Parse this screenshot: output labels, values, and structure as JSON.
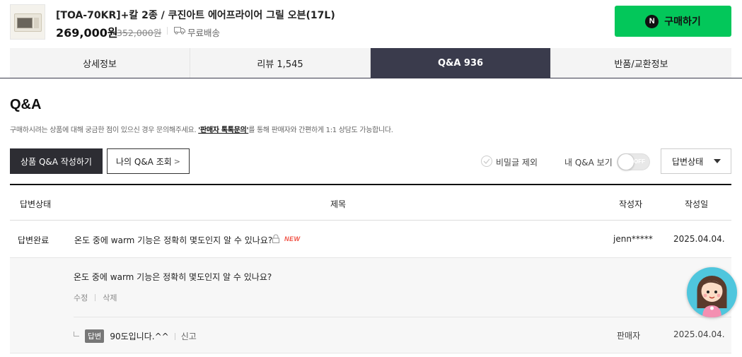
{
  "product": {
    "title": "[TOA-70KR]+칼 2종 / 쿠진아트 에어프라이어 그릴 오븐(17L)",
    "price": "269,000원",
    "original_price": "352,000원",
    "shipping": "무료배송",
    "buy_label": "구매하기",
    "naver_badge": "N",
    "buy_color": "#03c75a"
  },
  "tabs": [
    {
      "label": "상세정보",
      "active": false
    },
    {
      "label": "리뷰 1,545",
      "active": false
    },
    {
      "label": "Q&A 936",
      "active": true
    },
    {
      "label": "반품/교환정보",
      "active": false
    }
  ],
  "qa": {
    "title": "Q&A",
    "desc_before": "구매하시려는 상품에 대해 궁금한 점이 있으신 경우 문의해주세요. ",
    "desc_link": "'판매자 톡톡문의'",
    "desc_after": "를 통해 판매자와 간편하게 1:1 상담도 가능합니다.",
    "write_button": "상품 Q&A 작성하기",
    "my_qa_button": "나의 Q&A 조회",
    "secret_exclude_label": "비밀글 제외",
    "my_qa_view_label": "내 Q&A 보기",
    "toggle_state": "OFF",
    "status_filter": "답변상태"
  },
  "table": {
    "headers": {
      "status": "답변상태",
      "subject": "제목",
      "writer": "작성자",
      "date": "작성일"
    },
    "rows": [
      {
        "status": "답변완료",
        "subject": "온도 중에 warm 기능은 정확히 몇도인지 알 수 있나요?",
        "new_badge": "NEW",
        "writer": "jenn*****",
        "date": "2025.04.04.",
        "detail": {
          "question": "온도 중에 warm 기능은 정확히 몇도인지 알 수 있나요?",
          "edit": "수정",
          "delete": "삭제",
          "answer_badge": "답변",
          "answer": "90도입니다.^^",
          "report": "신고",
          "answer_writer": "판매자",
          "answer_date": "2025.04.04."
        }
      }
    ]
  }
}
